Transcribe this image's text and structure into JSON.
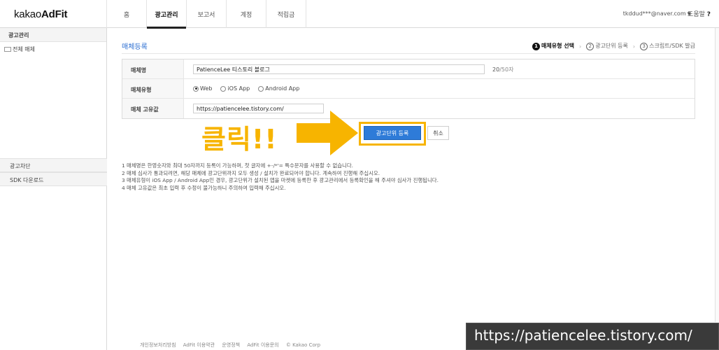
{
  "header": {
    "logo_light": "kakao",
    "logo_bold": "AdFit",
    "tabs": [
      {
        "label": "홈"
      },
      {
        "label": "광고관리"
      },
      {
        "label": "보고서"
      },
      {
        "label": "계정"
      },
      {
        "label": "적립금"
      }
    ],
    "active_tab": "광고관리",
    "account": "tkddud***@naver.com",
    "help_label": "도움말",
    "help_icon": "?"
  },
  "sidebar": {
    "section_title": "광고관리",
    "tree_item": "전체 매체",
    "blocking": "광고차단",
    "sdk_download": "SDK 다운로드"
  },
  "main": {
    "page_title": "매체등록",
    "steps": [
      {
        "num": "1",
        "label": "매체유형 선택"
      },
      {
        "num": "2",
        "label": "광고단위 등록"
      },
      {
        "num": "3",
        "label": "스크립트/SDK 발급"
      }
    ],
    "form": {
      "name_label": "매체명",
      "name_value": "PatienceLee 티스토리 블로그",
      "name_counter_current": "20",
      "name_counter_max": "/50자",
      "type_label": "매체유형",
      "type_options": [
        "Web",
        "iOS App",
        "Android App"
      ],
      "type_selected": "Web",
      "id_label": "매체 고유값",
      "id_value": "https://patiencelee.tistory.com/"
    },
    "buttons": {
      "register": "광고단위 등록",
      "cancel": "취소"
    },
    "annotation": "클릭!!",
    "notes": [
      "1  매체명은 한영숫자와 최대 50자까지 등록이 가능하며, 첫 글자에 +-/*'= 특수문자를 사용할 수 없습니다.",
      "2  매체 심사가 통과되려면, 해당 매체에 광고단위까지 모두 생성 / 설치가 완료되어야 합니다. 계속하여 진행해 주십시오.",
      "3  매체유형이 iOS App / Android App인 경우, 광고단위가 설치된 앱을 마켓에 등록한 후 광고관리에서 등록확인을 해 주셔야 심사가 진행됩니다.",
      "4  매체 고유값은 최초 입력 후 수정이 불가능하니 주의하여 입력해 주십시오."
    ]
  },
  "footer": {
    "links": [
      "개인정보처리방침",
      "AdFit 이용약관",
      "운영정책",
      "AdFit 이용문의",
      "© Kakao Corp"
    ]
  },
  "watermark": "https://patiencelee.tistory.com/",
  "colors": {
    "accent_blue": "#2e7bd8",
    "annotation_yellow": "#f7b400",
    "title_blue": "#2d6fd2"
  }
}
